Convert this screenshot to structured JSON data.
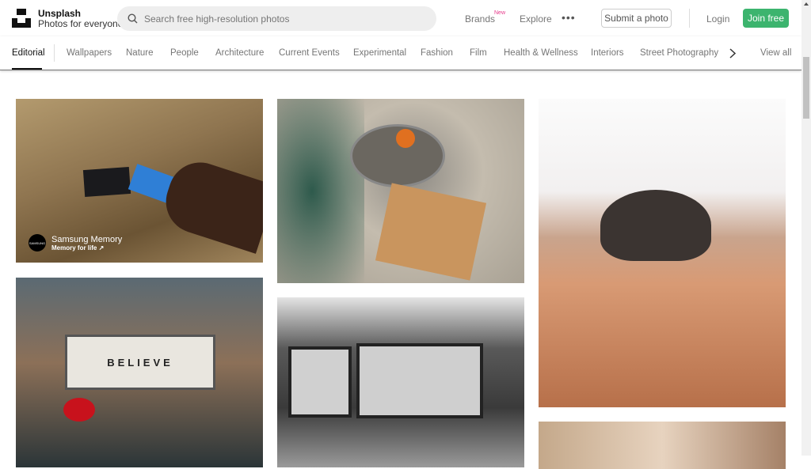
{
  "header": {
    "brand_name": "Unsplash",
    "tagline": "Photos for everyone",
    "search_placeholder": "Search free high-resolution photos",
    "nav": {
      "brands": "Brands",
      "brands_badge": "New",
      "explore": "Explore",
      "more": "•••"
    },
    "submit": "Submit a photo",
    "login": "Login",
    "join": "Join free",
    "join_color": "#3cb46e"
  },
  "tabs": {
    "items": [
      "Editorial",
      "Wallpapers",
      "Nature",
      "People",
      "Architecture",
      "Current Events",
      "Experimental",
      "Fashion",
      "Film",
      "Health & Wellness",
      "Interiors",
      "Street Photography"
    ],
    "active": "Editorial",
    "view_all": "View all"
  },
  "photos": {
    "sponsor_name": "Samsung Memory",
    "sponsor_sub": "Memory for life ↗",
    "sponsor_logo": "SAMSUNG",
    "marquee_text": "BELIEVE"
  }
}
